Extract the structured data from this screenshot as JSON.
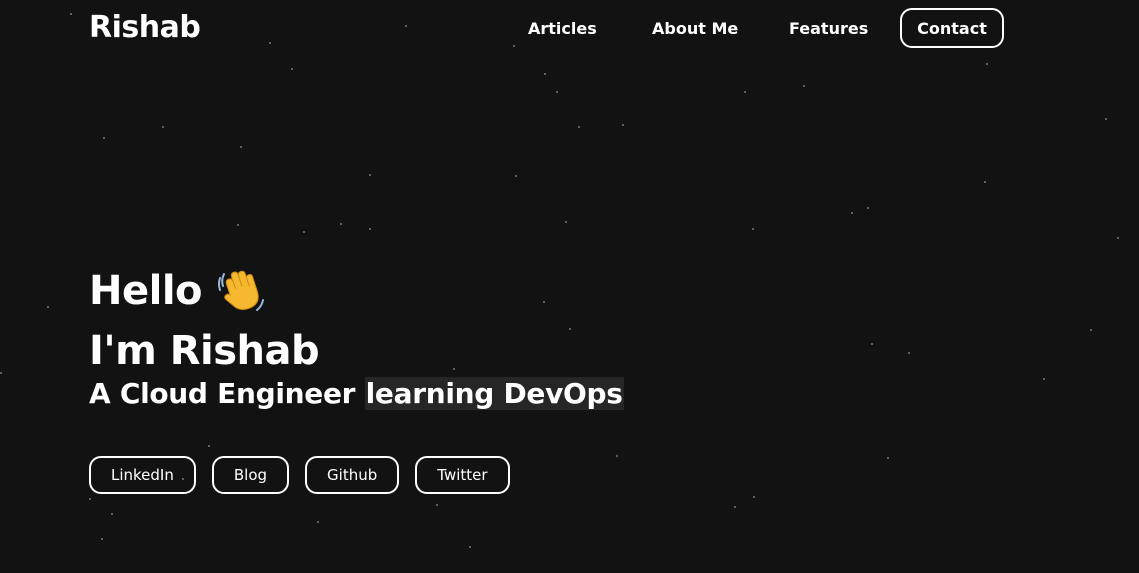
{
  "header": {
    "logo": "Rishab",
    "nav": {
      "articles": "Articles",
      "about": "About Me",
      "features": "Features",
      "contact": "Contact"
    }
  },
  "hero": {
    "greeting": "Hello",
    "greeting_icon": "waving-hand-icon",
    "name_line": "I'm Rishab",
    "tagline_start": "A Cloud Engineer ",
    "tagline_highlight": "learning DevOps"
  },
  "socials": {
    "linkedin": "LinkedIn",
    "blog": "Blog",
    "github": "Github",
    "twitter": "Twitter"
  },
  "colors": {
    "background": "#121212",
    "text": "#ffffff",
    "highlight_bg": "#262626",
    "star": "#7a7a7a",
    "wave_yellow": "#f5b82e"
  }
}
